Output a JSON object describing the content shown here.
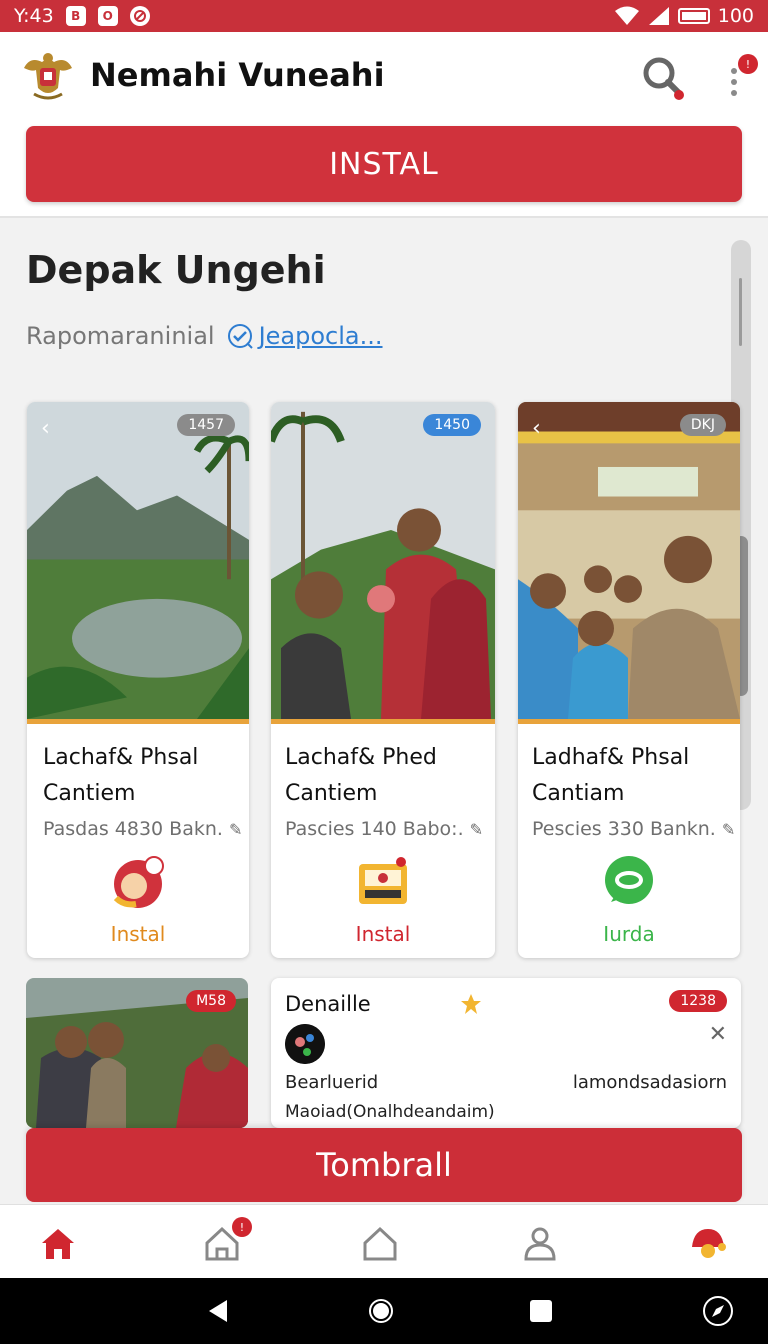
{
  "status_bar": {
    "time": "Y:43",
    "icon1": "B",
    "icon2": "O",
    "battery": "100"
  },
  "header": {
    "title": "Nemahi Vuneahi",
    "install_label": "INSTAL",
    "menu_badge": "!"
  },
  "section": {
    "title": "Depak Ungehi",
    "subtitle": "Rapomaraninial",
    "link": "Jeapocla..."
  },
  "cards": [
    {
      "badge": "1457",
      "name": "Lachaf& Phsal Cantiem",
      "meta": "Pasdas 4830 Bakn.",
      "action": "Instal",
      "action_color": "#e08a1e"
    },
    {
      "badge": "1450",
      "name": "Lachaf& Phed Cantiem",
      "meta": "Pascies  140 Babo:.",
      "action": "Instal",
      "action_color": "#d0262f"
    },
    {
      "badge": "DKJ",
      "name": "Ladhaf& Phsal Cantiam",
      "meta": "Pescies  330 Bankn.",
      "action": "Iurda",
      "action_color": "#3bb54a"
    }
  ],
  "photo_card": {
    "badge": "M58"
  },
  "notice": {
    "title": "Denaille",
    "badge": "1238",
    "left_text": "Bearluerid",
    "right_text": "lamondsadasiorn",
    "description": "Maoiad(Onalhdeandaim)"
  },
  "bottom_cta": "Tombrall",
  "bottom_nav": {
    "badge": "!"
  },
  "colors": {
    "brand_red": "#d0323c",
    "accent_orange": "#e8a33b",
    "link_blue": "#2e7dd1"
  }
}
